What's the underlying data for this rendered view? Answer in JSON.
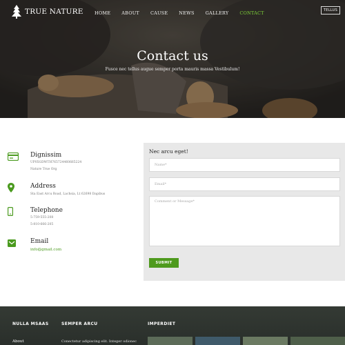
{
  "brand": {
    "name": "TRUE NATURE"
  },
  "nav": {
    "items": [
      "HOME",
      "ABOUT",
      "CAUSE",
      "NEWS",
      "GALLERY",
      "CONTACT"
    ],
    "active": "CONTACT",
    "button_label": "TELLUS"
  },
  "hero": {
    "title": "Contact us",
    "subtitle": "Fusce nec tellus augue semper porta mauris massa Vestibulum!"
  },
  "contact": {
    "items": [
      {
        "icon": "card-icon",
        "title": "Dignissim",
        "lines": [
          "UP05GDWTH765724460665224",
          "Nature True Org"
        ]
      },
      {
        "icon": "map-pin-icon",
        "title": "Address",
        "lines": [
          "Sta East Arcu Road, Lachsia, Lt 62698 Dapibus"
        ]
      },
      {
        "icon": "phone-icon",
        "title": "Telephone",
        "lines": [
          "5-759-555-208",
          "5-810-666-205"
        ]
      },
      {
        "icon": "mail-icon",
        "title": "Email",
        "lines": [
          "info@gmail.com"
        ]
      }
    ],
    "icon_color": "#4a9a1e"
  },
  "form": {
    "heading": "Nec arcu eget!",
    "name_placeholder": "Name*",
    "email_placeholder": "Email*",
    "message_placeholder": "Comment or Message*",
    "submit_label": "SUBMIT"
  },
  "footer": {
    "columns": [
      {
        "title": "NULLA MSAAS",
        "text": "About"
      },
      {
        "title": "SEMPER ARCU",
        "text": "Conectetur adipiscing elit. Integer odionec"
      },
      {
        "title": "IMPERDIET",
        "text": ""
      }
    ]
  },
  "colors": {
    "accent": "#4e9a1d",
    "active_nav": "#7fd43a"
  }
}
